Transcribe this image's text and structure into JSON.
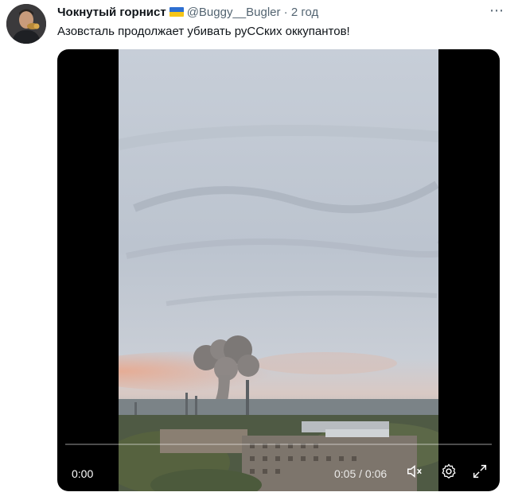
{
  "tweet": {
    "author_name": "Чокнутый горнист",
    "handle": "@Buggy__Bugler",
    "separator": "·",
    "time": "2 год",
    "text": "Азовсталь продолжает убивать руССких оккупантов!",
    "flag_colors": [
      "#2d6fd1",
      "#f5c518"
    ]
  },
  "video": {
    "elapsed": "0:00",
    "duration": "0:05 / 0:06",
    "progress_fraction": 0.0,
    "controls": [
      "mute-icon",
      "settings-icon",
      "fullscreen-icon"
    ]
  }
}
